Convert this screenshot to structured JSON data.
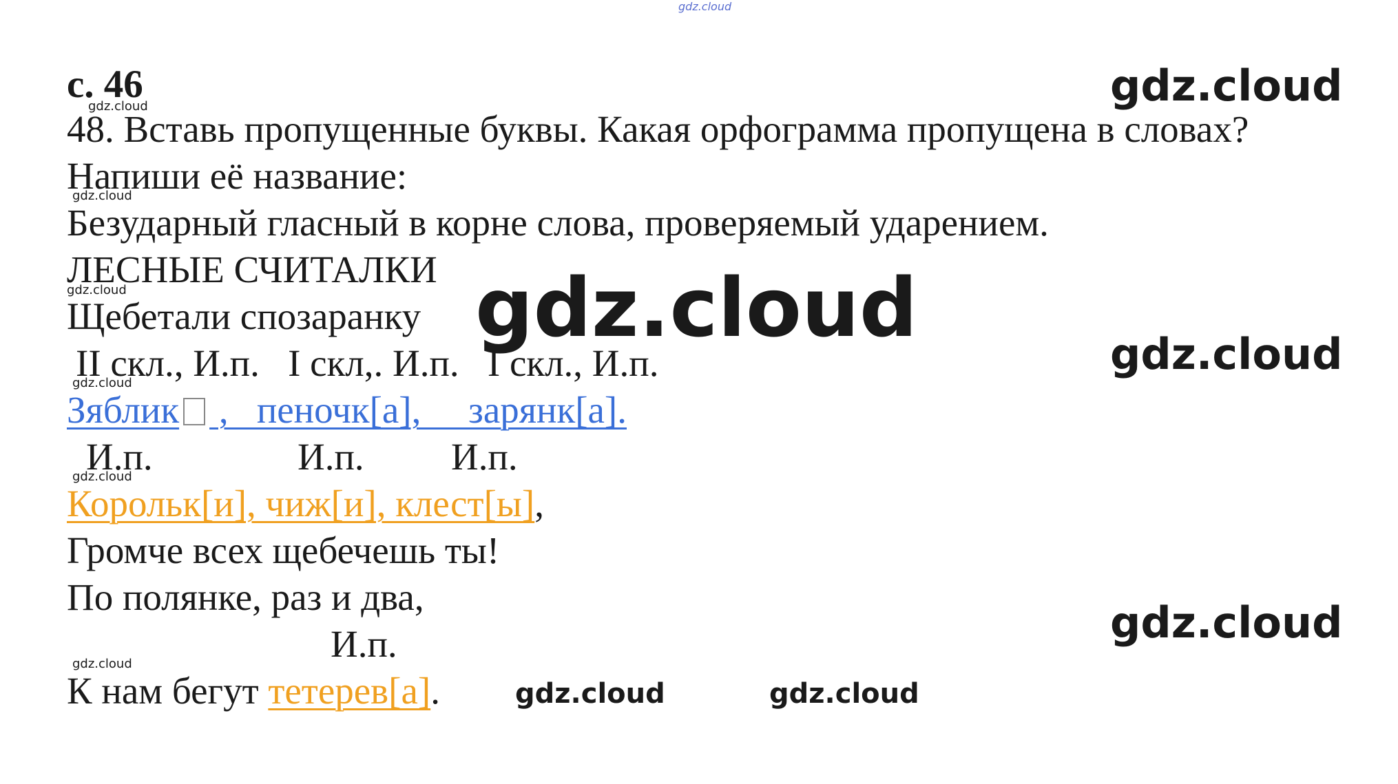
{
  "watermarks": {
    "text": "gdz.cloud"
  },
  "page": {
    "heading": "с. 46",
    "task": "48. Вставь пропущенные буквы. Какая орфограмма пропущена в словах?",
    "instruction": "Напиши её название:",
    "answer": "Безударный гласный в корне слова, проверяемый ударением.",
    "poem_title": "ЛЕСНЫЕ СЧИТАЛКИ",
    "line1": "Щебетали спозаранку",
    "ann1": "II скл., И.п.   I скл,. И.п.   I скл., И.п.",
    "line2_a": "Зяблик",
    "line2_b": " ,   пеночк[а],     зарянк[а].",
    "ann2_a": "И.п.",
    "ann2_b": "И.п.",
    "ann2_c": "И.п.",
    "line3": "Корольк[и], чиж[и], клест[ы]",
    "line3_tail": ",",
    "line4": "Громче всех щебечешь ты!",
    "line5": "По полянке, раз и два,",
    "ann3": "И.п.",
    "line6_a": "К нам бегут ",
    "line6_b": "тетерев[а]",
    "line6_c": "."
  },
  "colors": {
    "blue": "#3a6fd8",
    "orange": "#f0a020"
  }
}
